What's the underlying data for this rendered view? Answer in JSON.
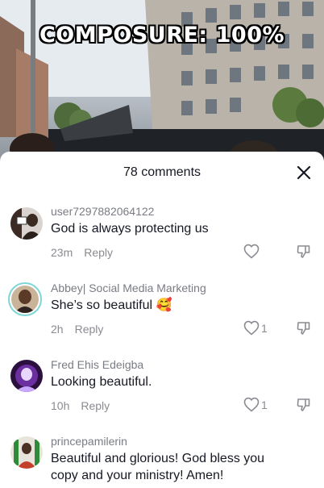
{
  "video": {
    "overlay_text": "COMPOSURE: 100%"
  },
  "comments_panel": {
    "title": "78 comments",
    "reply_label": "Reply",
    "comments": [
      {
        "username": "user7297882064122",
        "text": "God is always protecting us",
        "time": "23m",
        "likes": ""
      },
      {
        "username": "Abbey| Social Media Marketing",
        "text": "She’s so beautiful",
        "emoji": "🥰",
        "time": "2h",
        "likes": "1"
      },
      {
        "username": "Fred Ehis Edeigba",
        "text": "Looking beautiful.",
        "time": "10h",
        "likes": "1"
      },
      {
        "username": "princepamilerin",
        "text": "Beautiful and glorious! God bless you",
        "text_line2": "copy and your ministry! Amen!"
      }
    ]
  },
  "colors": {
    "accent_ring": "#7fd6d6",
    "text_primary": "#161823",
    "text_secondary": "#8a8b91"
  }
}
